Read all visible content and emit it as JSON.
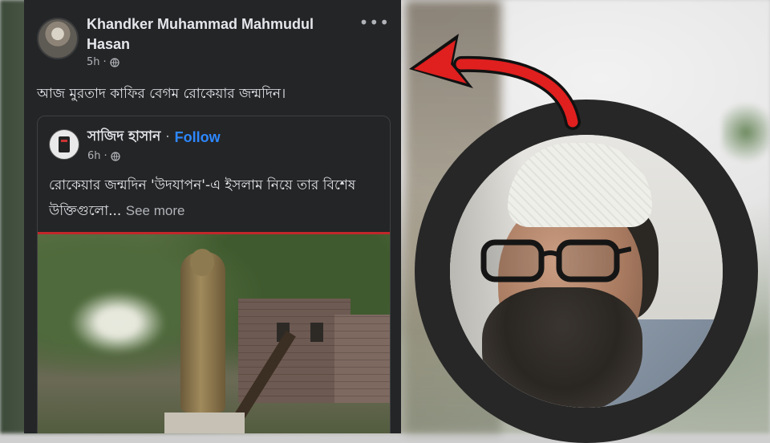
{
  "post": {
    "author_name": "Khandker Muhammad Mahmudul Hasan",
    "time": "5h",
    "text": "আজ  মুরতাদ কাফির বেগম রোকেয়ার জন্মদিন।"
  },
  "shared_post": {
    "author_name": "সাজিদ হাসান",
    "separator": "·",
    "follow_label": "Follow",
    "time": "6h",
    "text": "রোকেয়ার জন্মদিন 'উদযাপন'-এ ইসলাম নিয়ে তার বিশেষ উক্তিগুলো...",
    "see_more_label": "See more"
  },
  "colors": {
    "card_bg": "#242526",
    "follow_blue": "#2d88ff",
    "arrow_red": "#e01f1f"
  },
  "icons": {
    "more": "more-options-icon",
    "privacy": "globe-icon",
    "annotation": "curved-arrow"
  }
}
